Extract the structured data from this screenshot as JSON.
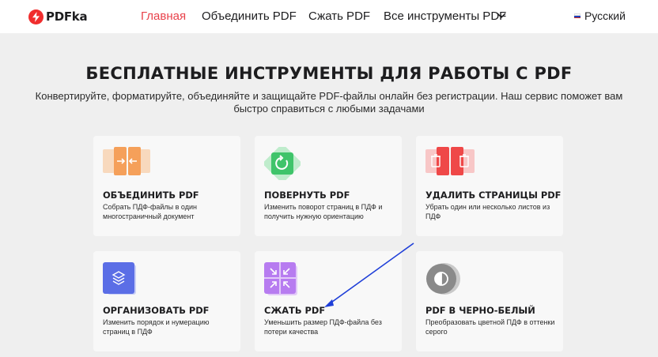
{
  "colors": {
    "brand": "#e8414a",
    "card_bg": "#f8f8f8",
    "page_bg": "#efefef"
  },
  "header": {
    "logo_text": "PDFka",
    "logo_icon": "lightning-icon",
    "nav": [
      {
        "label": "Главная",
        "active": true
      },
      {
        "label": "Объединить PDF",
        "active": false
      },
      {
        "label": "Сжать PDF",
        "active": false
      },
      {
        "label": "Все инструменты PDF",
        "active": false,
        "icon": "chevron-down-icon"
      }
    ],
    "language": {
      "label": "Русский",
      "icon": "flag-ru-icon"
    }
  },
  "hero": {
    "title": "БЕСПЛАТНЫЕ ИНСТРУМЕНТЫ ДЛЯ РАБОТЫ С PDF",
    "subtitle": "Конвертируйте, форматируйте, объединяйте и защищайте PDF-файлы онлайн без регистрации. Наш сервис поможет вам быстро справиться с любыми задачами"
  },
  "tools": [
    {
      "title": "ОБЪЕДИНИТЬ PDF",
      "description": "Собрать ПДФ-файлы в один многостраничный документ",
      "icon": "merge-icon",
      "color": "#f5a05a"
    },
    {
      "title": "ПОВЕРНУТЬ PDF",
      "description": "Изменить поворот страниц в ПДФ и получить нужную ориентацию",
      "icon": "rotate-icon",
      "color": "#3fc46a"
    },
    {
      "title": "УДАЛИТЬ СТРАНИЦЫ PDF",
      "description": "Убрать один или несколько листов из ПДФ",
      "icon": "trash-icon",
      "color": "#ef4848"
    },
    {
      "title": "ОРГАНИЗОВАТЬ PDF",
      "description": "Изменить порядок и нумерацию страниц в ПДФ",
      "icon": "layers-icon",
      "color": "#5b6ee6"
    },
    {
      "title": "СЖАТЬ PDF",
      "description": "Уменьшить размер ПДФ-файла без потери качества",
      "icon": "compress-icon",
      "color": "#b77cf0"
    },
    {
      "title": "PDF В ЧЕРНО-БЕЛЫЙ",
      "description": "Преобразовать цветной ПДФ в оттенки серого",
      "icon": "grayscale-icon",
      "color": "#8a8a8a"
    }
  ],
  "annotation": {
    "type": "arrow",
    "color": "#1f3fd8",
    "target": "СЖАТЬ PDF"
  }
}
